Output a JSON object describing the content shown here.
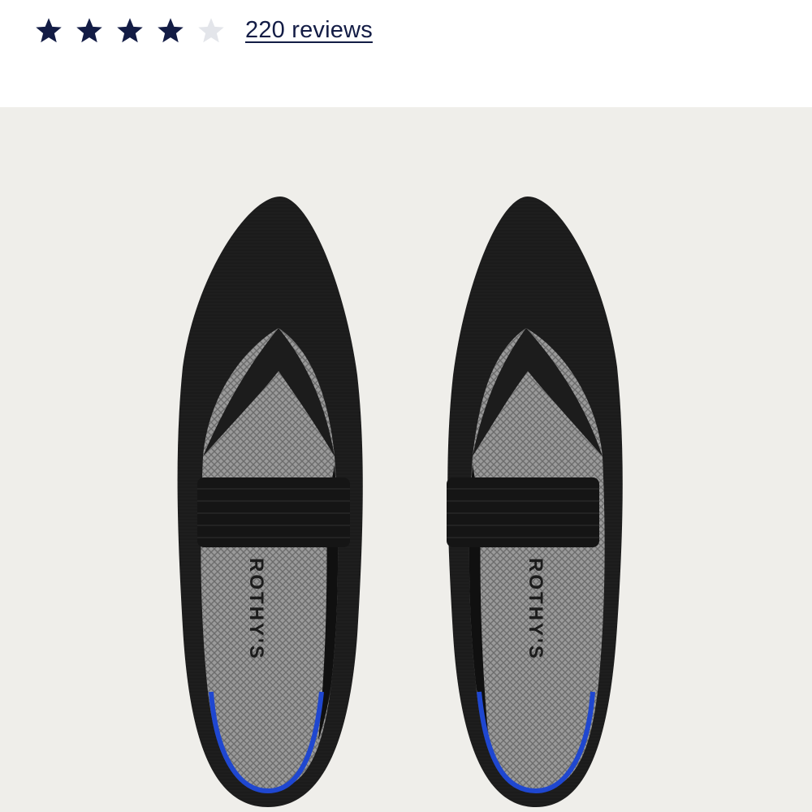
{
  "rating": {
    "value": 4,
    "max": 5,
    "filled_color": "#131c45",
    "empty_color": "#e3e5ea",
    "star_icon": "star-icon"
  },
  "reviews": {
    "label": "220 reviews"
  },
  "product": {
    "insole_brand": "ROTHY'S",
    "colors": {
      "background": "#efeeea",
      "knit": "#1a1a1a",
      "insole": "#8c8c8c",
      "heel_stripe": "#1f47d0"
    }
  }
}
